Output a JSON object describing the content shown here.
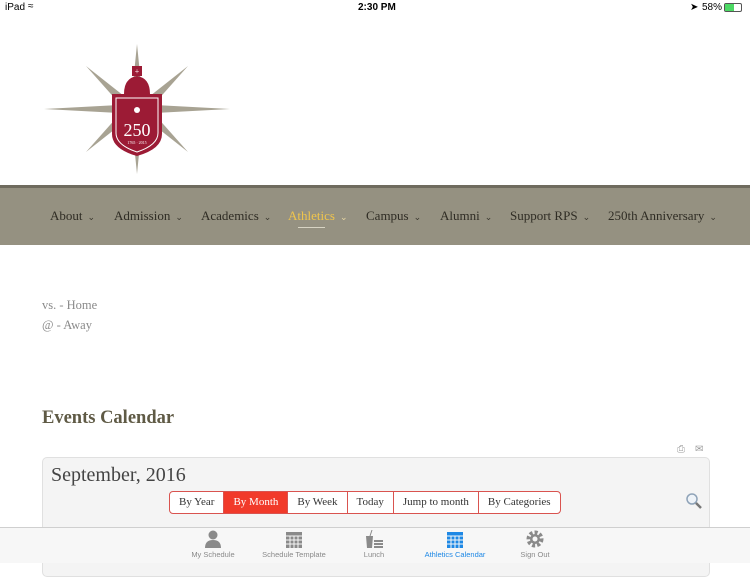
{
  "status_bar": {
    "device": "iPad",
    "time": "2:30 PM",
    "battery": "58%",
    "battery_level": 0.58
  },
  "logo": {
    "text": "250",
    "years": "1765 2015"
  },
  "nav": {
    "items": [
      {
        "label": "About"
      },
      {
        "label": "Admission"
      },
      {
        "label": "Academics"
      },
      {
        "label": "Athletics",
        "active": true
      },
      {
        "label": "Campus"
      },
      {
        "label": "Alumni"
      },
      {
        "label": "Support RPS"
      },
      {
        "label": "250th Anniversary"
      }
    ]
  },
  "legend": {
    "home": "vs. - Home",
    "away": "@ - Away"
  },
  "calendar": {
    "heading": "Events Calendar",
    "month": "September, 2016",
    "views": [
      {
        "label": "By Year"
      },
      {
        "label": "By Month",
        "active": true
      },
      {
        "label": "By Week"
      },
      {
        "label": "Today"
      },
      {
        "label": "Jump to month"
      },
      {
        "label": "By Categories"
      }
    ],
    "accent": "#f13a2a"
  },
  "tabbar": {
    "items": [
      {
        "label": "My Schedule",
        "icon": "person-icon"
      },
      {
        "label": "Schedule Template",
        "icon": "calendar-grid-icon"
      },
      {
        "label": "Lunch",
        "icon": "lunch-icon"
      },
      {
        "label": "Athletics Calendar",
        "icon": "calendar-icon",
        "active": true
      },
      {
        "label": "Sign Out",
        "icon": "gear-icon"
      }
    ],
    "active_color": "#1e88e5"
  }
}
